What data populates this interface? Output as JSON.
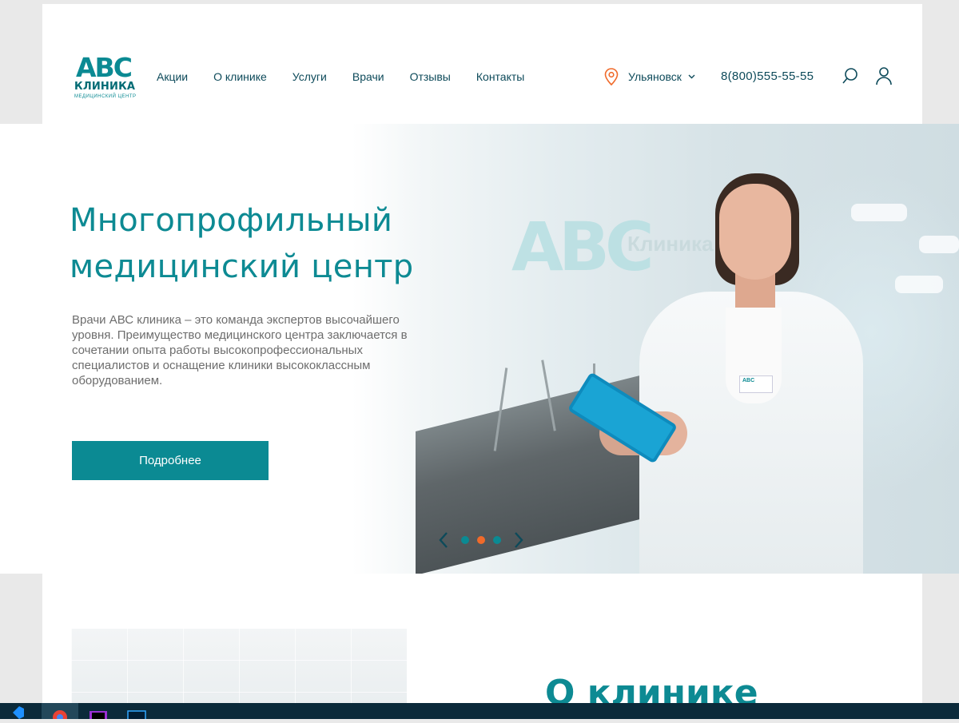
{
  "header": {
    "logo": {
      "mark": "ABC",
      "name": "КЛИНИКА",
      "subtitle": "МЕДИЦИНСКИЙ ЦЕНТР"
    },
    "nav": [
      "Акции",
      "О клинике",
      "Услуги",
      "Врачи",
      "Отзывы",
      "Контакты"
    ],
    "city": "Ульяновск",
    "phone": "8(800)555-55-55",
    "icons": [
      "location-pin-icon",
      "chevron-down-icon",
      "search-icon",
      "user-icon"
    ]
  },
  "hero": {
    "title_line1": "Многопрофильный",
    "title_line2": "медицинский центр",
    "description": "Врачи АВС клиника – это команда экспертов высочайшего уровня. Преимущество медицинского центра  заключается в сочетании опыта работы высокопрофессиональных специалистов и оснащение клиники высококлассным оборудованием.",
    "button": "Подробнее",
    "photo_watermark": "ABC",
    "photo_watermark_text": "Клиника",
    "badge": "ABC",
    "slider": {
      "active_index": 1,
      "count": 3
    }
  },
  "about": {
    "title": "О клинике"
  },
  "colors": {
    "accent": "#0b8a93",
    "dark": "#0d4a5a",
    "dot_active": "#f06a2a",
    "dot": "#0b8a93"
  },
  "taskbar": {
    "apps": [
      "vscode-icon",
      "chrome-icon",
      "phpstorm-icon",
      "photoshop-icon"
    ]
  }
}
